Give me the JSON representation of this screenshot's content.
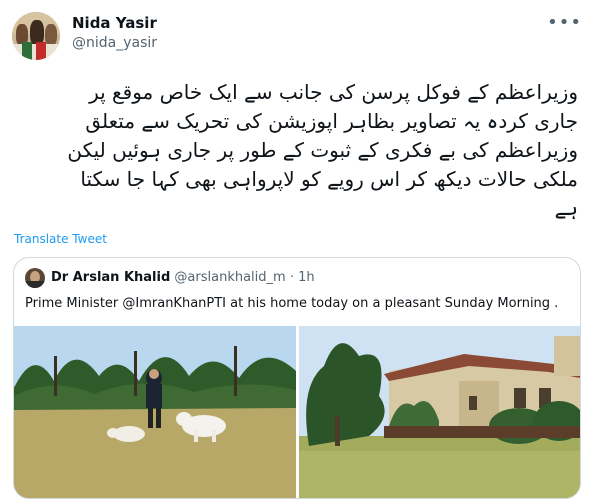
{
  "author": {
    "name": "Nida Yasir",
    "handle": "@nida_yasir"
  },
  "tweet": {
    "text_lines": [
      "وزیراعظم کے فوکل پرسن کی جانب سے ایک خاص موقع پر",
      "جاری کردہ یہ تصاویر بظاہر اپوزیشن کی تحریک سے متعلق",
      "وزیراعظم کی بے فکری کے ثبوت کے طور پر جاری ہوئیں لیکن",
      "ملکی حالات دیکھ کر اس رویے کو لاپرواہی بھی کہا جا سکتا",
      "ہے"
    ],
    "translate_label": "Translate Tweet",
    "more_icon": "more-options-icon"
  },
  "quote": {
    "name": "Dr Arslan Khalid",
    "handle": "@arslankhalid_m · 1h",
    "text": "Prime Minister @ImranKhanPTI at his home today on a pleasant Sunday Morning ."
  },
  "colors": {
    "link": "#1d9bf0",
    "muted": "#536471",
    "border": "#cfd9de"
  }
}
